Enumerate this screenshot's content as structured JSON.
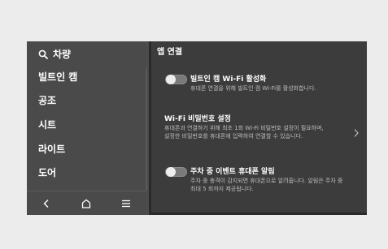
{
  "sidebar": {
    "search_label": "차량",
    "items": [
      {
        "label": "빌트인 캠"
      },
      {
        "label": "공조"
      },
      {
        "label": "시트"
      },
      {
        "label": "라이트"
      },
      {
        "label": "도어"
      }
    ]
  },
  "panel": {
    "title": "앱 연결",
    "settings": [
      {
        "title": "빌트인 캠 Wi-Fi 활성화",
        "desc": [
          "휴대폰 연결을 위해 빌트인 캠 Wi-Fi를 활성화합니다."
        ],
        "toggle_on": false
      },
      {
        "title": "Wi-Fi 비밀번호 설정",
        "desc": [
          "휴대폰과 연결하기 위해 최초 1회 Wi-Fi 비밀번호 설정이 필요하며,",
          "설정한 비밀번호를 휴대폰에 입력하여 연결할 수 있습니다."
        ]
      },
      {
        "title": "주차 중 이벤트 휴대폰 알림",
        "desc": [
          "주차 중 충격이 감지되면 휴대폰으로 알려줍니다. 알림은 주차 중",
          "최대 5 회까지 제공됩니다."
        ],
        "toggle_on": false
      }
    ]
  },
  "nav": {
    "icons": [
      "back-icon",
      "home-icon",
      "menu-icon"
    ]
  }
}
